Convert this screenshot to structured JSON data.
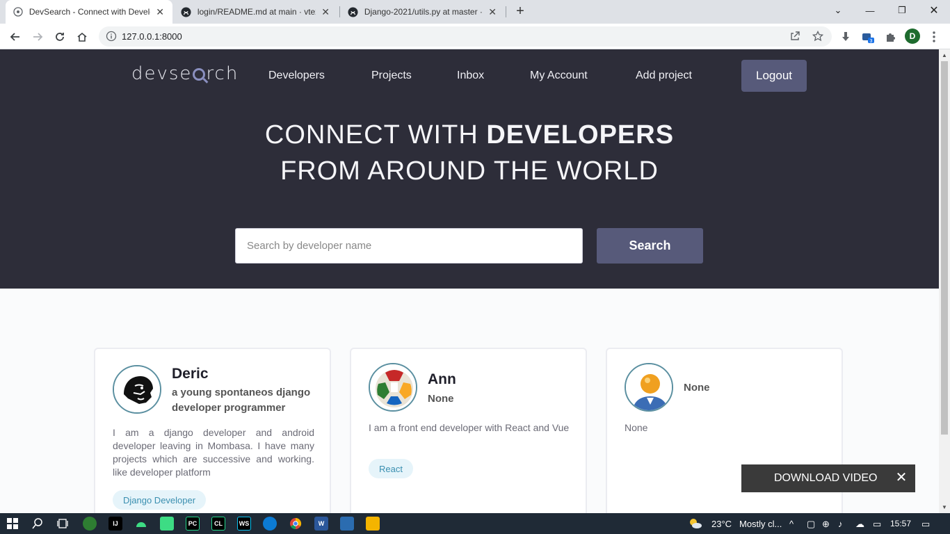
{
  "browser": {
    "tabs": [
      {
        "title": "DevSearch - Connect with Develo",
        "active": true
      },
      {
        "title": "login/README.md at main · vtex",
        "active": false
      },
      {
        "title": "Django-2021/utils.py at master ·",
        "active": false
      }
    ],
    "url": "127.0.0.1:8000",
    "profile_initial": "D",
    "extension_badge": "3"
  },
  "site": {
    "logo": {
      "pre": "devse",
      "post": "rch"
    },
    "nav": [
      "Developers",
      "Projects",
      "Inbox",
      "My Account",
      "Add project"
    ],
    "logout_label": "Logout",
    "hero": {
      "line1_light": "CONNECT WITH ",
      "line1_bold": "DEVELOPERS",
      "line2": "FROM AROUND THE WORLD"
    },
    "search": {
      "placeholder": "Search by developer name",
      "button_label": "Search"
    },
    "developers": [
      {
        "name": "Deric",
        "headline": "a young spontaneos django developer programmer",
        "bio": "I am a django developer and android developer leaving in Mombasa. I have many projects which are successive and working. like developer platform",
        "skills": [
          "Django Developer"
        ],
        "avatar": "lion-icon"
      },
      {
        "name": "Ann",
        "headline": "None",
        "bio": "I am a front end developer with React and Vue",
        "skills": [
          "React"
        ],
        "avatar": "ball-icon"
      },
      {
        "name": "",
        "headline": "None",
        "bio": "None",
        "skills": [],
        "avatar": "default-user-icon"
      }
    ]
  },
  "overlay": {
    "download_label": "DOWNLOAD VIDEO"
  },
  "taskbar": {
    "weather": "23°C",
    "weather_desc": "Mostly cl...",
    "time": "15:57"
  },
  "colors": {
    "hero_bg": "#2d2d39",
    "accent_button": "#575a7a",
    "tag_bg": "#e6f4fa",
    "tag_text": "#3a8fb0"
  }
}
